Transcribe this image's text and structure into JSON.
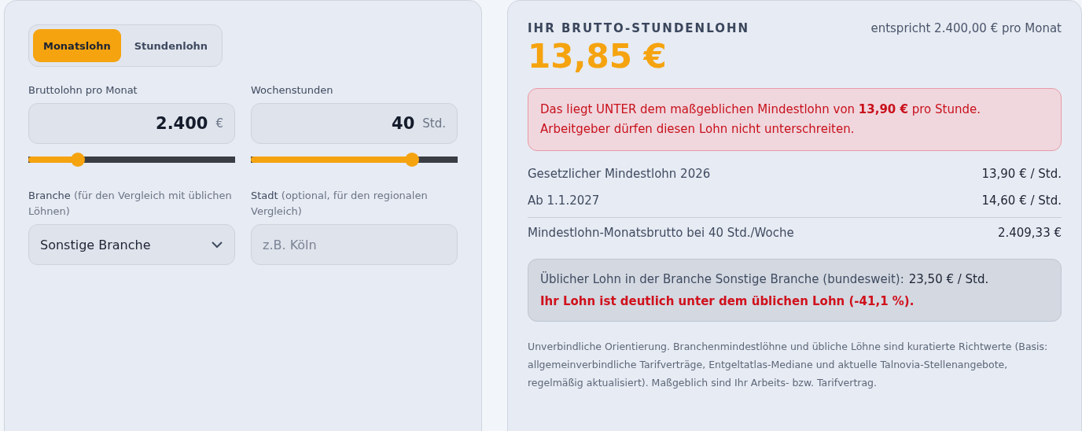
{
  "mode_tabs": [
    {
      "label": "Monatslohn",
      "selected": true
    },
    {
      "label": "Stundenlohn",
      "selected": false
    }
  ],
  "inputs": [
    {
      "label": "Bruttolohn pro Monat",
      "value": "2.400",
      "unit": "€",
      "level": 0.22
    },
    {
      "label": "Wochenstunden",
      "value": "40",
      "unit": "Std.",
      "level": 0.8
    }
  ],
  "branche": {
    "label": "**Branche** (für den Vergleich mit üblichen Löhnen)",
    "value": "Sonstige Branche"
  },
  "stadt": {
    "label": "**Stadt** (optional, für den regionalen Vergleich)",
    "placeholder": "z.B. Köln"
  },
  "result": {
    "title": "IHR BRUTTO-STUNDENLOHN",
    "equivalent": "entspricht 2.400,00 € pro Monat",
    "amount": "13,85 €"
  },
  "alert": {
    "text": "Das liegt UNTER dem maßgeblichen Mindestlohn von **13,90 €** pro Stunde. Arbeitgeber dürfen diesen Lohn nicht unterschreiten."
  },
  "rates": [
    {
      "label": "Gesetzlicher Mindestlohn 2026",
      "value": "13,90 € / Std."
    },
    {
      "label": "Ab 1.1.2027",
      "value": "14,60 € / Std."
    }
  ],
  "monthly": {
    "label": "Mindestlohn-Monatsbrutto bei 40 Std./Woche",
    "value": "2.409,33 €"
  },
  "comparison": {
    "label": "Üblicher Lohn in der Branche Sonstige Branche (bundesweit):",
    "value": "23,50 € / Std.",
    "warning": "Ihr Lohn ist deutlich unter dem üblichen Lohn (-41,1 %)."
  },
  "disclaimer": "Unverbindliche Orientierung. Branchenmindestlöhne und übliche Löhne sind kuratierte Richtwerte (Basis: allgemeinverbindliche Tarifverträge, Entgeltatlas-Mediane und aktuelle Talnovia-Stellenangebote, regelmäßig aktualisiert). Maßgeblich sind Ihr Arbeits- bzw. Tarifvertrag."
}
